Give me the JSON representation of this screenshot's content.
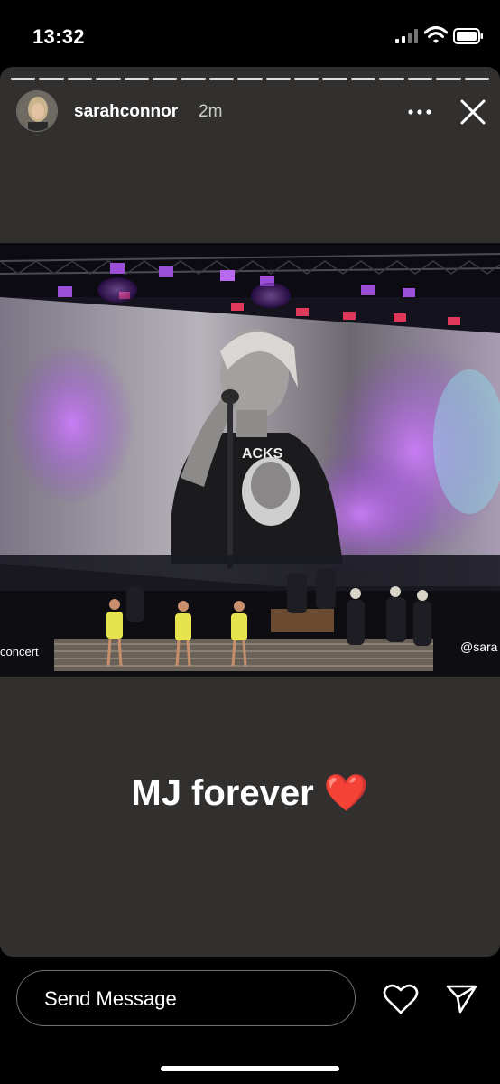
{
  "status_bar": {
    "time": "13:32"
  },
  "story": {
    "username": "sarahconnor",
    "time_ago": "2m",
    "caption": "MJ forever",
    "caption_emoji": "❤️",
    "photo_overlay_left": "concert",
    "photo_overlay_right": "@sara",
    "shirt_text": "ACKS",
    "progress_segments": 17
  },
  "reply": {
    "placeholder": "Send Message"
  },
  "icons": [
    "signal-icon",
    "wifi-icon",
    "battery-icon",
    "more-icon",
    "close-icon",
    "heart-icon",
    "send-icon"
  ],
  "colors": {
    "card_background": "#32302e",
    "heart": "#e0383e",
    "stage_purple": "#9b4fd8"
  }
}
